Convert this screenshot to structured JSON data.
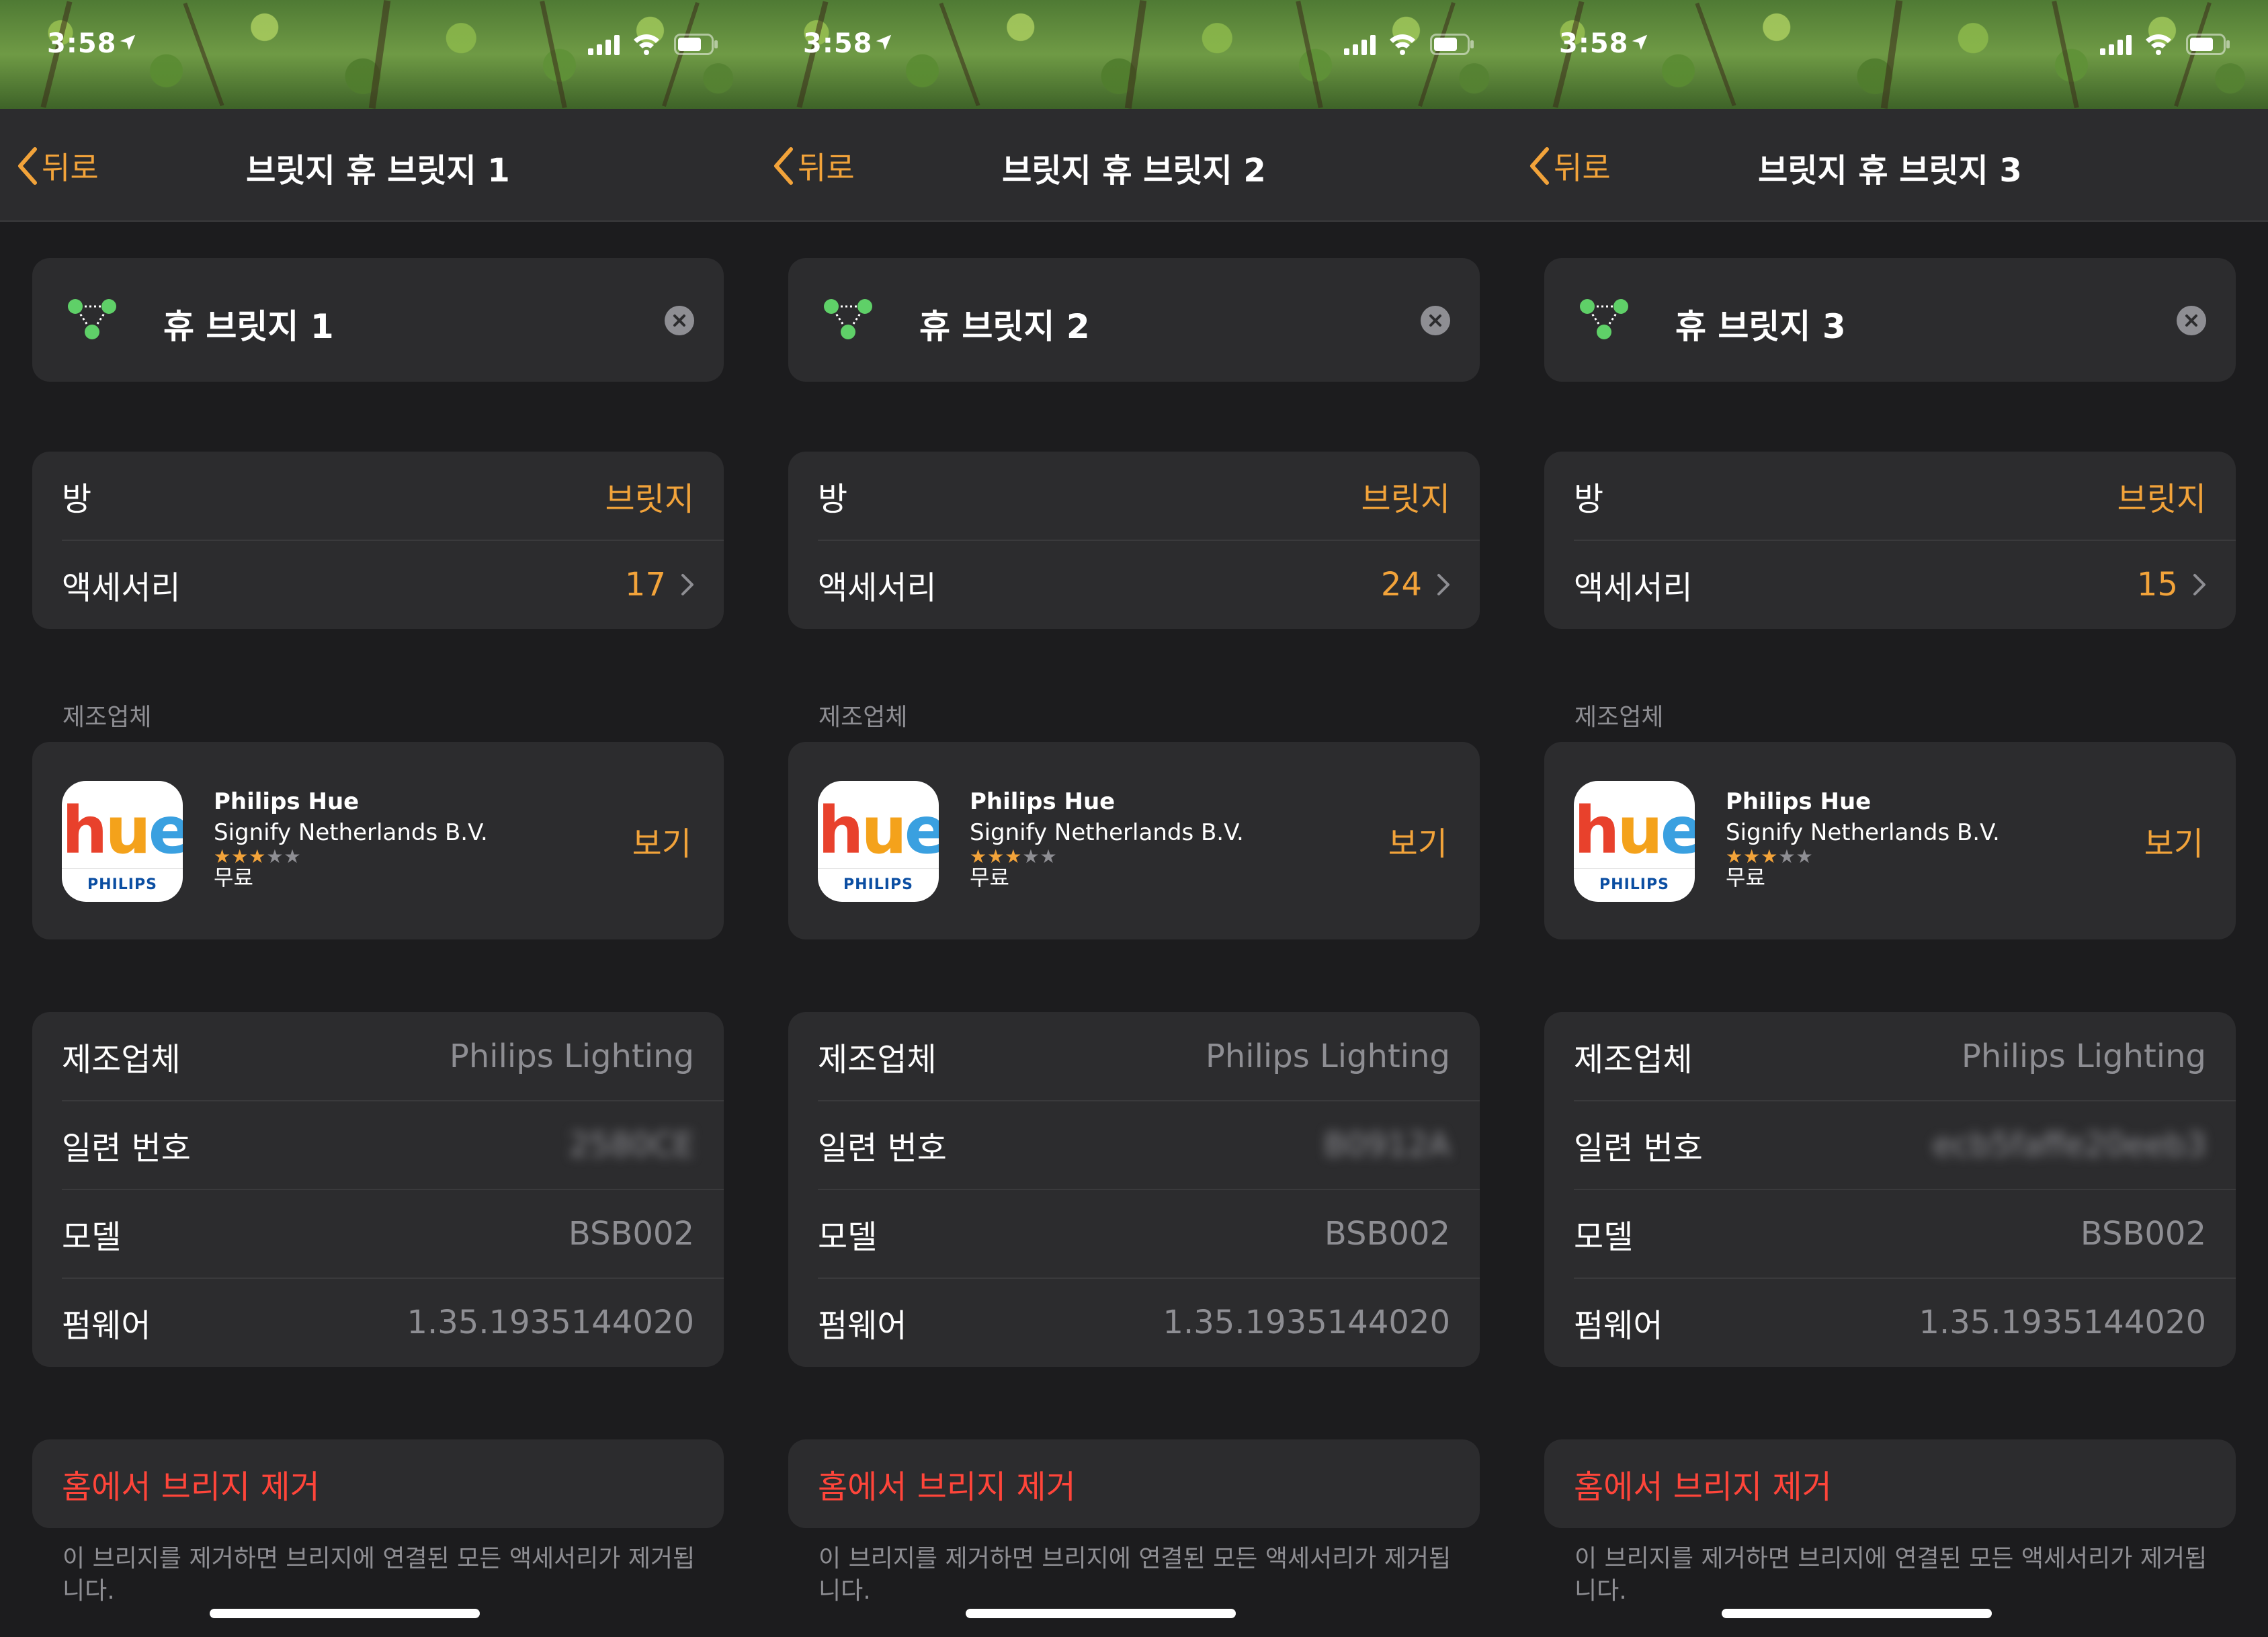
{
  "colors": {
    "accent": "#f2a33a",
    "destructive": "#ff453a",
    "secondary_text": "#8e8e93",
    "background": "#1c1c1e",
    "card": "#2c2c2e"
  },
  "screens": [
    {
      "status": {
        "time": "3:58"
      },
      "nav": {
        "back_label": "뒤로",
        "title": "브릿지 휴 브릿지 1"
      },
      "accessory_name": "휴 브릿지 1",
      "room": {
        "label": "방",
        "value": "브릿지"
      },
      "accessories": {
        "label": "액세서리",
        "value": "17"
      },
      "manufacturer_section": "제조업체",
      "app": {
        "icon_text": "hue",
        "icon_brand": "PHILIPS",
        "name": "Philips Hue",
        "developer": "Signify Netherlands B.V.",
        "rating": 3,
        "rating_max": 5,
        "price": "무료",
        "view_label": "보기"
      },
      "details": [
        {
          "label": "제조업체",
          "value": "Philips Lighting",
          "blurred": false
        },
        {
          "label": "일련 번호",
          "value": "2580CE",
          "blurred": true
        },
        {
          "label": "모델",
          "value": "BSB002",
          "blurred": false
        },
        {
          "label": "펌웨어",
          "value": "1.35.1935144020",
          "blurred": false
        }
      ],
      "remove_label": "홈에서 브리지 제거",
      "footer_note": "이 브리지를 제거하면 브리지에 연결된 모든 액세서리가 제거됩니다."
    },
    {
      "status": {
        "time": "3:58"
      },
      "nav": {
        "back_label": "뒤로",
        "title": "브릿지 휴 브릿지 2"
      },
      "accessory_name": "휴 브릿지 2",
      "room": {
        "label": "방",
        "value": "브릿지"
      },
      "accessories": {
        "label": "액세서리",
        "value": "24"
      },
      "manufacturer_section": "제조업체",
      "app": {
        "icon_text": "hue",
        "icon_brand": "PHILIPS",
        "name": "Philips Hue",
        "developer": "Signify Netherlands B.V.",
        "rating": 3,
        "rating_max": 5,
        "price": "무료",
        "view_label": "보기"
      },
      "details": [
        {
          "label": "제조업체",
          "value": "Philips Lighting",
          "blurred": false
        },
        {
          "label": "일련 번호",
          "value": "B0912A",
          "blurred": true
        },
        {
          "label": "모델",
          "value": "BSB002",
          "blurred": false
        },
        {
          "label": "펌웨어",
          "value": "1.35.1935144020",
          "blurred": false
        }
      ],
      "remove_label": "홈에서 브리지 제거",
      "footer_note": "이 브리지를 제거하면 브리지에 연결된 모든 액세서리가 제거됩니다."
    },
    {
      "status": {
        "time": "3:58"
      },
      "nav": {
        "back_label": "뒤로",
        "title": "브릿지 휴 브릿지 3"
      },
      "accessory_name": "휴 브릿지 3",
      "room": {
        "label": "방",
        "value": "브릿지"
      },
      "accessories": {
        "label": "액세서리",
        "value": "15"
      },
      "manufacturer_section": "제조업체",
      "app": {
        "icon_text": "hue",
        "icon_brand": "PHILIPS",
        "name": "Philips Hue",
        "developer": "Signify Netherlands B.V.",
        "rating": 3,
        "rating_max": 5,
        "price": "무료",
        "view_label": "보기"
      },
      "details": [
        {
          "label": "제조업체",
          "value": "Philips Lighting",
          "blurred": false
        },
        {
          "label": "일련 번호",
          "value": "ecb5faffe20eeb3",
          "blurred": true
        },
        {
          "label": "모델",
          "value": "BSB002",
          "blurred": false
        },
        {
          "label": "펌웨어",
          "value": "1.35.1935144020",
          "blurred": false
        }
      ],
      "remove_label": "홈에서 브리지 제거",
      "footer_note": "이 브리지를 제거하면 브리지에 연결된 모든 액세서리가 제거됩니다."
    }
  ]
}
